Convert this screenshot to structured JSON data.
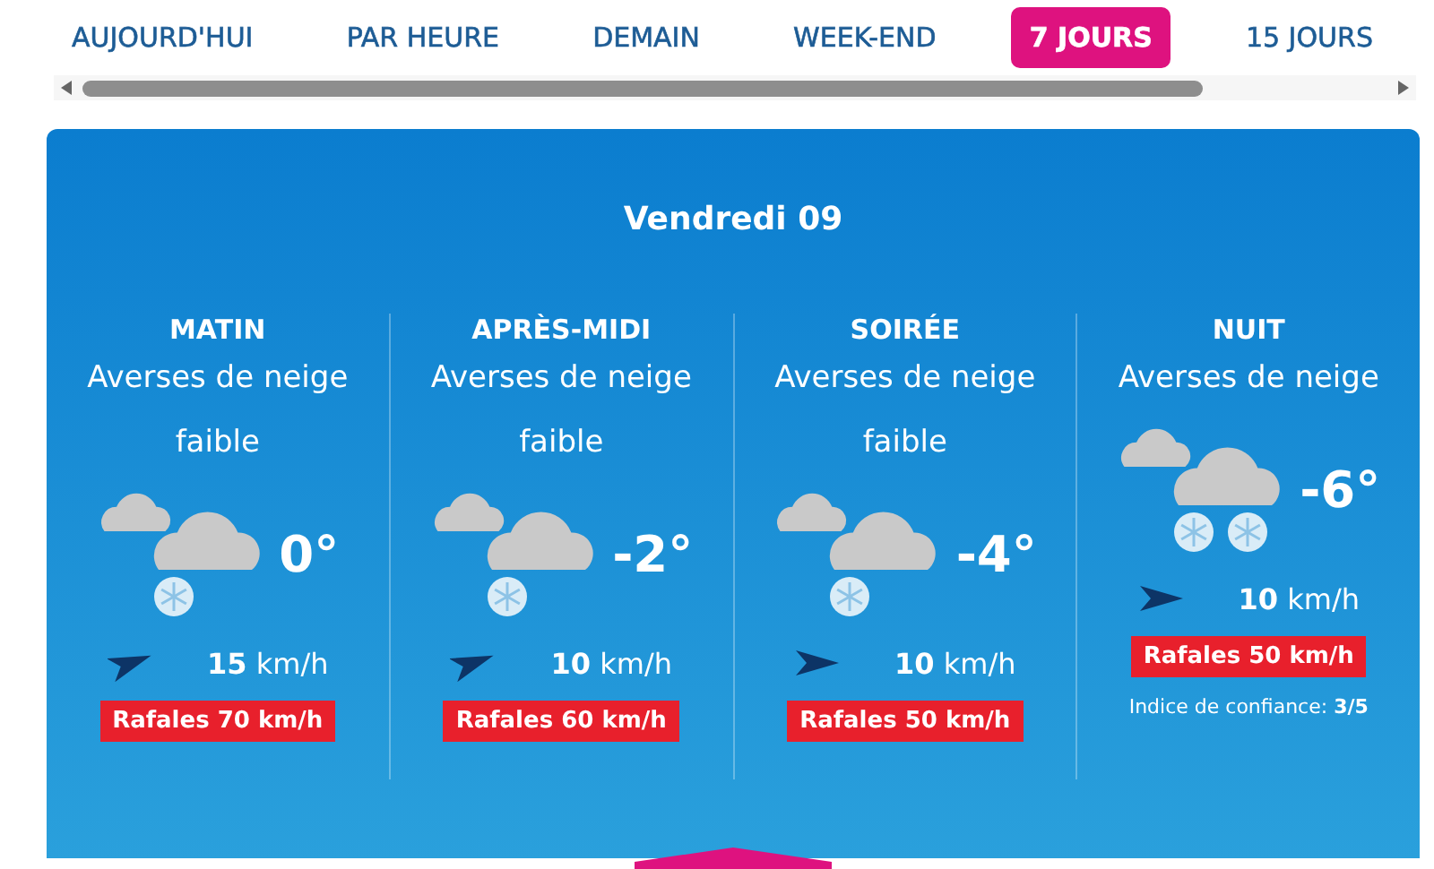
{
  "tabs": [
    {
      "label": "AUJOURD'HUI",
      "selected": false
    },
    {
      "label": "PAR HEURE",
      "selected": false
    },
    {
      "label": "DEMAIN",
      "selected": false
    },
    {
      "label": "WEEK-END",
      "selected": false
    },
    {
      "label": "7 JOURS",
      "selected": true
    },
    {
      "label": "15 JOURS",
      "selected": false
    }
  ],
  "day": {
    "title": "Vendredi 09",
    "periods": [
      {
        "name": "MATIN",
        "description": "Averses de neige faible",
        "kind": "showers",
        "temperature": "0°",
        "wind": "**15** km/h",
        "gusts": "Rafales 70 km/h"
      },
      {
        "name": "APRÈS-MIDI",
        "description": "Averses de neige faible",
        "kind": "showers",
        "temperature": "-2°",
        "wind": "**10** km/h",
        "gusts": "Rafales 60 km/h"
      },
      {
        "name": "SOIRÉE",
        "description": "Averses de neige faible",
        "kind": "showers",
        "temperature": "-4°",
        "wind": "**10** km/h",
        "gusts": "Rafales 50 km/h"
      },
      {
        "name": "NUIT",
        "description": "Averses de neige",
        "kind": "snow",
        "temperature": "-6°",
        "wind": "**10** km/h",
        "gusts": "Rafales 50 km/h",
        "confidence": "Indice de confiance: **3/5**"
      }
    ]
  }
}
